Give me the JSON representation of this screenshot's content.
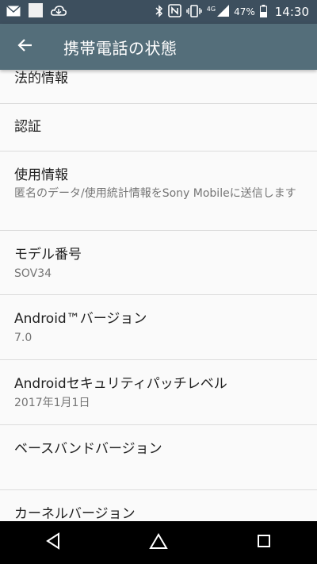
{
  "status_bar": {
    "network_label": "4G",
    "battery": "47%",
    "time": "14:30",
    "icons": [
      "mail-icon",
      "image-icon",
      "cloud-download-icon",
      "bluetooth-icon",
      "nfc-icon",
      "vibrate-icon",
      "signal-icon",
      "battery-icon"
    ]
  },
  "app_bar": {
    "title": "携帯電話の状態",
    "back_icon": "arrow-back-icon"
  },
  "settings": {
    "legal": {
      "title": "法的情報"
    },
    "certification": {
      "title": "認証"
    },
    "usage": {
      "title": "使用情報",
      "subtitle": "匿名のデータ/使用統計情報をSony Mobileに送信します"
    },
    "model": {
      "title": "モデル番号",
      "value": "SOV34"
    },
    "android_version": {
      "title": "Android™バージョン",
      "value": "7.0"
    },
    "security_patch": {
      "title": "Androidセキュリティパッチレベル",
      "value": "2017年1月1日"
    },
    "baseband": {
      "title": "ベースバンドバージョン",
      "value": ""
    },
    "kernel": {
      "title": "カーネルバージョン"
    }
  },
  "nav_bar": {
    "icons": [
      "back-triangle-icon",
      "home-icon",
      "recents-icon"
    ]
  },
  "colors": {
    "status_bar": "#3d4f5e",
    "app_bar": "#546e7a",
    "background": "#fafafa"
  }
}
